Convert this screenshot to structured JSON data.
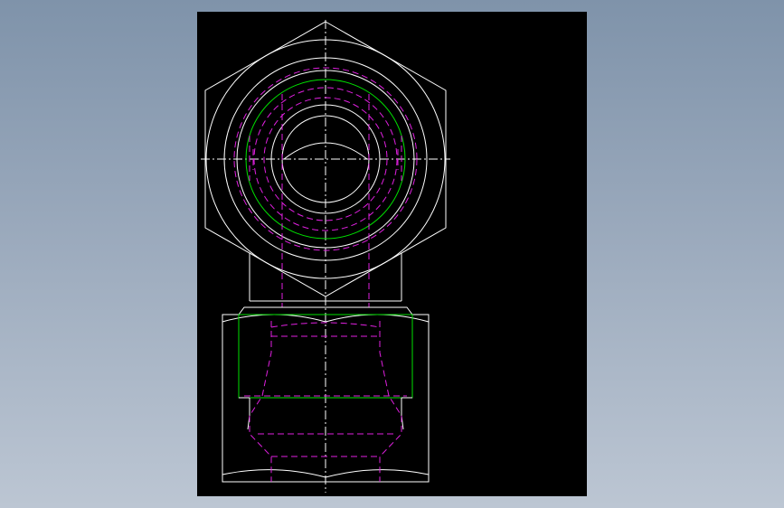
{
  "drawing": {
    "background": "#000000",
    "colors": {
      "outline": "#ffffff",
      "thread_major": "#00e000",
      "hidden": "#e020e0",
      "centerline": "#ffffff"
    },
    "views": [
      "top-view-hex-nut",
      "front-view-fitting-body"
    ]
  }
}
